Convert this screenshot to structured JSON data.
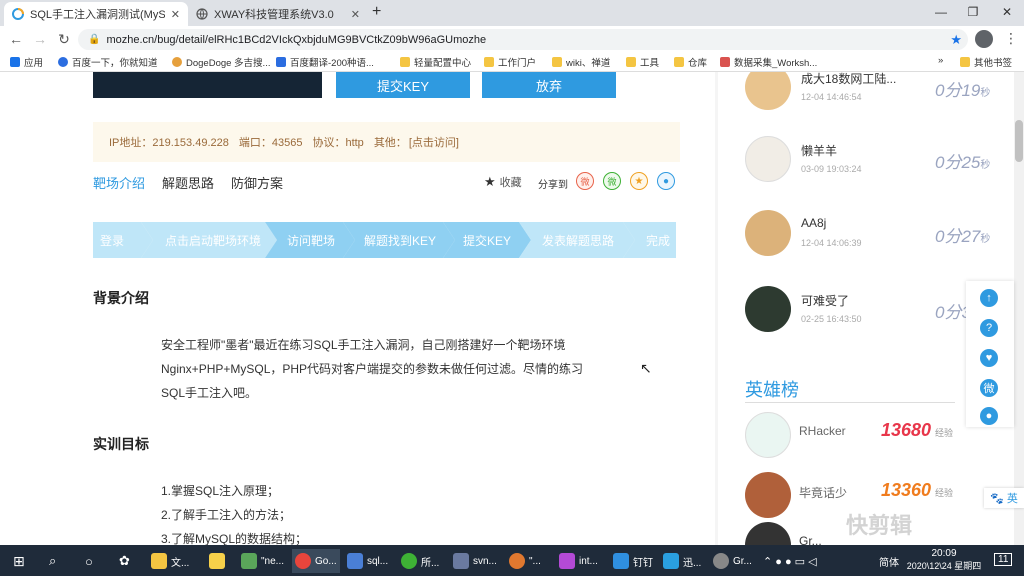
{
  "browser": {
    "tabs": [
      {
        "title": "SQL手工注入漏洞测试(MySQL数",
        "active": true
      },
      {
        "title": "XWAY科技管理系统V3.0",
        "active": false
      }
    ],
    "new_tab": "+",
    "url": "mozhe.cn/bug/detail/elRHc1BCd2VIckQxbjduMG9BVCtkZ09bW96aGUmozhe",
    "bookmarks": [
      "应用",
      "百度一下，你就知道",
      "DogeDoge 多吉搜...",
      "百度翻译-200种语...",
      "轻量配置中心",
      "工作门户",
      "wiki、禅道",
      "工具",
      "仓库",
      "数据采集_Worksh...",
      "其他书签"
    ],
    "more": "»"
  },
  "page": {
    "buttons": {
      "submit_key": "提交KEY",
      "give_up": "放弃"
    },
    "ip_info": {
      "ip": "IP地址：219.153.49.228",
      "port": "端口：43565",
      "protocol": "协议：http",
      "other": "其他：",
      "link": "[点击访问]"
    },
    "tabs": [
      "靶场介绍",
      "解题思路",
      "防御方案"
    ],
    "favorite": "收藏",
    "share": "分享到",
    "steps": [
      "登录",
      "点击启动靶场环境",
      "访问靶场",
      "解题找到KEY",
      "提交KEY",
      "发表解题思路",
      "完成"
    ],
    "background": {
      "heading": "背景介绍",
      "lines": [
        "安全工程师\"墨者\"最近在练习SQL手工注入漏洞，自己刚搭建好一个靶场环境",
        "Nginx+PHP+MySQL，PHP代码对客户端提交的参数未做任何过滤。尽情的练习",
        "SQL手工注入吧。"
      ]
    },
    "goals": {
      "heading": "实训目标",
      "lines": [
        "1.掌握SQL注入原理；",
        "2.了解手工注入的方法；",
        "3.了解MySQL的数据结构；"
      ]
    }
  },
  "sidebar": {
    "ranking": [
      {
        "name": "成大18数网工陆...",
        "time": "12-04 14:46:54",
        "score_main": "0分19",
        "unit": "秒"
      },
      {
        "name": "懒羊羊",
        "time": "03-09 19:03:24",
        "score_main": "0分25",
        "unit": "秒"
      },
      {
        "name": "AA8j",
        "time": "12-04 14:06:39",
        "score_main": "0分27",
        "unit": "秒"
      },
      {
        "name": "可难受了",
        "time": "02-25 16:43:50",
        "score_main": "0分32",
        "unit": "秒"
      }
    ],
    "hero_title": "英雄榜",
    "heroes": [
      {
        "name": "RHacker",
        "score": "13680",
        "unit": "经验",
        "color": "#e8364a"
      },
      {
        "name": "毕竟话少",
        "score": "13360",
        "unit": "经验",
        "color": "#f07c1e"
      },
      {
        "name": "Gr...",
        "score": "",
        "unit": "",
        "color": "#333"
      }
    ],
    "float_icons": [
      "arrow-up-icon",
      "question-icon",
      "handshake-icon",
      "weibo-icon",
      "wechat-icon"
    ],
    "lang_badge": "英",
    "watermark": "快剪辑"
  },
  "taskbar": {
    "items": [
      "文...",
      "\"ne...",
      "Go...",
      "sql...",
      "所...",
      "svn...",
      "\"...",
      "int...",
      "钉钉",
      "迅...",
      "Gr..."
    ],
    "ime": "简体",
    "time": "20:09",
    "date": "2020\\12\\24 星期四",
    "badge": "11"
  },
  "colors": {
    "accent": "#2f9ae0",
    "steps_active": "#8fd0f2",
    "steps_inactive": "#bfe6f8"
  }
}
